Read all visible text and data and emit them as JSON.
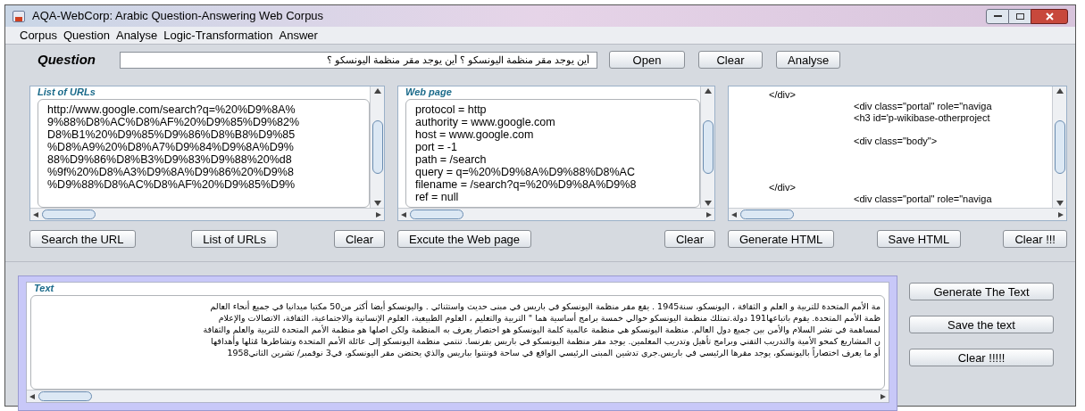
{
  "window": {
    "title": "AQA-WebCorp: Arabic Question-Answering Web Corpus"
  },
  "menu": [
    "Corpus",
    "Question",
    "Analyse",
    "Logic-Transformation",
    "Answer"
  ],
  "question": {
    "label": "Question",
    "value": "أين يوجد مقر منظمة اليونسكو ؟ أين يوجد مقر منظمة اليونسكو ؟"
  },
  "question_buttons": [
    "Open",
    "Clear",
    "Analyse"
  ],
  "panels": [
    {
      "title": "List of URLs",
      "lines": [
        {
          "text": "http://www.google.com/search?q=%20%D9%8A%",
          "kind": "plain"
        },
        {
          "text": "9%88%D8%AC%D8%AF%20%D9%85%D9%82%",
          "kind": "plain"
        },
        {
          "text": "D8%B1%20%D9%85%D9%86%D8%B8%D9%85",
          "kind": "plain"
        },
        {
          "text": "%D8%A9%20%D8%A7%D9%84%D9%8A%D9%",
          "kind": "plain"
        },
        {
          "text": "88%D9%86%D8%B3%D9%83%D9%88%20%d8",
          "kind": "plain"
        },
        {
          "text": "%9f%20%D8%A3%D9%8A%D9%86%20%D9%8",
          "kind": "plain"
        },
        {
          "text": "%D9%88%D8%AC%D8%AF%20%D9%85%D9%",
          "kind": "plain"
        }
      ],
      "buttons": [
        "Search the URL",
        "List of URLs",
        "Clear"
      ]
    },
    {
      "title": "Web page",
      "lines": [
        {
          "text": "protocol = http",
          "kind": "plain"
        },
        {
          "text": "authority = www.google.com",
          "kind": "plain"
        },
        {
          "text": "host = www.google.com",
          "kind": "plain"
        },
        {
          "text": "port = -1",
          "kind": "plain"
        },
        {
          "text": "path = /search",
          "kind": "plain"
        },
        {
          "text": "query = q=%20%D9%8A%D9%88%D8%AC",
          "kind": "plain"
        },
        {
          "text": "filename = /search?q=%20%D9%8A%D9%8",
          "kind": "plain"
        },
        {
          "text": "ref = null",
          "kind": "plain"
        }
      ],
      "buttons": [
        "Excute  the Web page",
        "Clear"
      ]
    },
    {
      "lines": [
        {
          "text": "</div>",
          "kind": "outer"
        },
        {
          "text": "<div class=\"portal\" role=\"naviga",
          "kind": "inner"
        },
        {
          "text": "<h3 id='p-wikibase-otherproject",
          "kind": "inner"
        },
        {
          "kind": "blank"
        },
        {
          "text": "<div class=\"body\">",
          "kind": "inner"
        },
        {
          "kind": "blank"
        },
        {
          "kind": "blank"
        },
        {
          "kind": "blank"
        },
        {
          "text": "</div>",
          "kind": "outer"
        },
        {
          "text": "<div class=\"portal\" role=\"naviga",
          "kind": "inner"
        }
      ],
      "buttons": [
        "Generate HTML",
        "Save HTML",
        "Clear !!!"
      ]
    }
  ],
  "text_panel": {
    "title": "Text",
    "lines": [
      "مة الأمم المتحدة للتربية و العلم و الثقافة ، اليونسكو، سنة1945 . يقع مقر منظمة اليونسكو في باريس في مبنى حديث واستثنائي . واليونسكو أيضا أكثر من50 مكتبا ميدانيا في جميع أنحاء العالم",
      "ظمة الأمم المتحدة. يقوم باتباعها191 دولة.تمتلك منظمة اليونسكو حوالي خمسة برامج أساسية هما \" التربية والتعليم ، العلوم الطبيعية، العلوم الإنسانية والاجتماعية، الثقافة، الاتصالات والإعلام",
      "لمساهمة في نشر السلام والأمن بين جميع دول العالم. منظمة اليونسكو هي منظمة عالمية كلمة اليونسكو هو اختصار يعرف به المنظمة ولكن اصلها هو منظمة الأمم المتحدة للتربية والعلم والثقافة",
      "ن المشاريع كمحو الأمية والتدريب التقني وبرامج تأهيل وتدريب المعلمين. يوجد مقر منظمة اليونسكو في باريس بفرنسا. تنتمي منظمة اليونسكو إلى عائلة الأمم المتحدة وتشاطرها مُثلها وأهدافها",
      "أو ما يعرف اختصاراً باليونسكو، يوجد مقرها الرئيسي في باريس.جرى تدشين المبنى الرئيسي الواقع في ساحة فونتنوا بباريس والذي يحتضن مقر اليونسكو، في3 نوفمبر/ تشرين الثاني1958"
    ]
  },
  "text_buttons": [
    "Generate The Text",
    "Save the text",
    "Clear !!!!!"
  ]
}
